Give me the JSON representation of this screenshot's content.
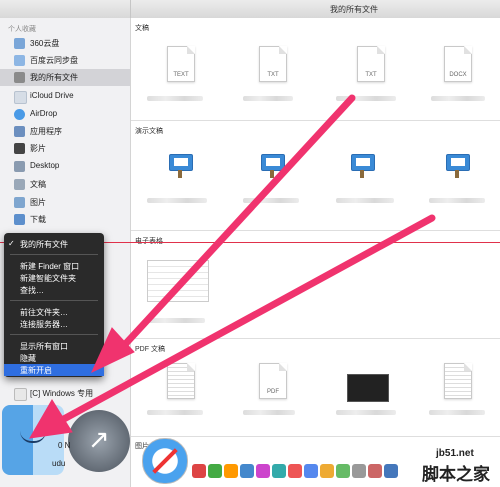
{
  "window": {
    "title": "我的所有文件"
  },
  "sidebar": {
    "heading": "个人收藏",
    "items": [
      {
        "label": "360云盘",
        "icon": "cloud-icon",
        "color": "#7aa6d8"
      },
      {
        "label": "百度云同步盘",
        "icon": "folder-icon",
        "color": "#8db6e4"
      },
      {
        "label": "我的所有文件",
        "icon": "all-files-icon",
        "color": "#8a8a8a",
        "selected": true
      },
      {
        "label": "iCloud Drive",
        "icon": "icloud-icon",
        "color": "#d6dde6"
      },
      {
        "label": "AirDrop",
        "icon": "airdrop-icon",
        "color": "#4a9ae6"
      },
      {
        "label": "应用程序",
        "icon": "applications-icon",
        "color": "#6c8fbf"
      },
      {
        "label": "影片",
        "icon": "movies-icon",
        "color": "#444444"
      },
      {
        "label": "Desktop",
        "icon": "desktop-icon",
        "color": "#8a9bb0"
      },
      {
        "label": "文稿",
        "icon": "documents-icon",
        "color": "#9aa8b8"
      },
      {
        "label": "图片",
        "icon": "pictures-icon",
        "color": "#7fa6cf"
      },
      {
        "label": "下载",
        "icon": "downloads-icon",
        "color": "#5d8fcc"
      }
    ],
    "windows_item": "[C] Windows 专用"
  },
  "sections": [
    {
      "label": "文稿",
      "files": [
        "TEXT",
        "TXT",
        "TXT",
        "DOCX"
      ]
    },
    {
      "label": "演示文稿",
      "files": [
        "",
        "",
        "",
        ""
      ]
    },
    {
      "label": "电子表格",
      "files": [
        ""
      ]
    },
    {
      "label": "PDF 文稿",
      "files": [
        "",
        "PDF",
        "",
        ""
      ]
    },
    {
      "label": "图片"
    }
  ],
  "context_menu": {
    "checked_item": "我的所有文件",
    "group1": [
      "新建 Finder 窗口",
      "新建智能文件夹",
      "查找…"
    ],
    "group2": [
      "前往文件夹…",
      "连接服务器…"
    ],
    "group3": [
      "显示所有窗口",
      "隐藏"
    ],
    "highlighted": "重新开启"
  },
  "dock": {
    "partial_labels": [
      "0 N",
      "udu"
    ]
  },
  "watermark": {
    "site": "jb51.net",
    "name": "脚本之家"
  },
  "colors": {
    "arrow": "#f0336e",
    "menu_highlight": "#2f6ee0",
    "redline": "#e0314b"
  }
}
